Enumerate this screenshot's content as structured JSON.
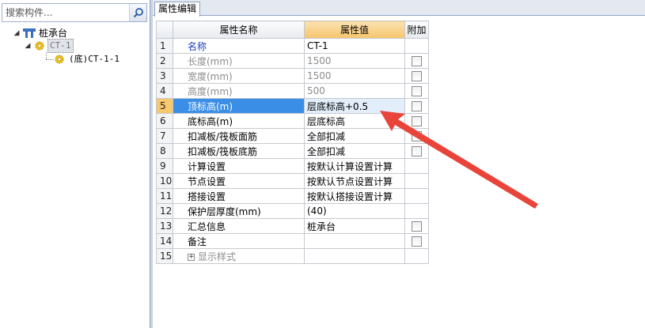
{
  "search": {
    "placeholder": "搜索构件..."
  },
  "tree": {
    "root": "桩承台",
    "child": "CT-1",
    "grandchild": "(底)CT-1-1"
  },
  "tab": {
    "label": "属性编辑"
  },
  "grid": {
    "headers": {
      "name": "属性名称",
      "value": "属性值",
      "extra": "附加"
    },
    "rows": [
      {
        "num": "1",
        "name": "名称",
        "value": "CT-1",
        "checkbox": false
      },
      {
        "num": "2",
        "name": "长度(mm)",
        "value": "1500",
        "checkbox": true
      },
      {
        "num": "3",
        "name": "宽度(mm)",
        "value": "1500",
        "checkbox": true
      },
      {
        "num": "4",
        "name": "高度(mm)",
        "value": "500",
        "checkbox": true
      },
      {
        "num": "5",
        "name": "顶标高(m)",
        "value": "层底标高+0.5",
        "checkbox": true
      },
      {
        "num": "6",
        "name": "底标高(m)",
        "value": "层底标高",
        "checkbox": true
      },
      {
        "num": "7",
        "name": "扣减板/筏板面筋",
        "value": "全部扣减",
        "checkbox": true
      },
      {
        "num": "8",
        "name": "扣减板/筏板底筋",
        "value": "全部扣减",
        "checkbox": true
      },
      {
        "num": "9",
        "name": "计算设置",
        "value": "按默认计算设置计算",
        "checkbox": false
      },
      {
        "num": "10",
        "name": "节点设置",
        "value": "按默认节点设置计算",
        "checkbox": false
      },
      {
        "num": "11",
        "name": "搭接设置",
        "value": "按默认搭接设置计算",
        "checkbox": false
      },
      {
        "num": "12",
        "name": "保护层厚度(mm)",
        "value": "(40)",
        "checkbox": false
      },
      {
        "num": "13",
        "name": "汇总信息",
        "value": "桩承台",
        "checkbox": true
      },
      {
        "num": "14",
        "name": "备注",
        "value": "",
        "checkbox": true
      },
      {
        "num": "15",
        "name": "显示样式",
        "value": "",
        "checkbox": false
      }
    ]
  },
  "colors": {
    "accent_arrow": "#e8443a",
    "selected_row": "#3a8ee6",
    "header_value": "#f5c56e"
  }
}
